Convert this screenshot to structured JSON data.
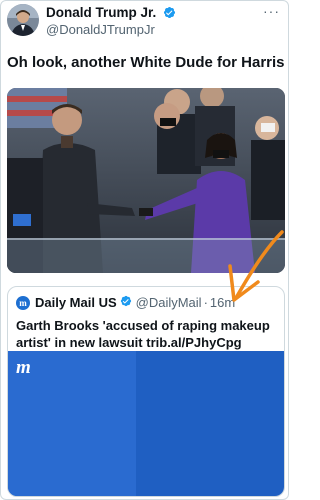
{
  "post": {
    "author_name": "Donald Trump Jr.",
    "author_handle": "@DonaldJTrumpJr",
    "text": "Oh look, another White Dude for Harris",
    "more_label": "···"
  },
  "quoted_post": {
    "logo_letter": "m",
    "author_name": "Daily Mail US",
    "author_handle": "@DailyMail",
    "separator": "·",
    "time": "16m",
    "text": "Garth Brooks 'accused of raping makeup artist' in new lawsuit",
    "link": "trib.al/PJhyCpg",
    "media_mark": "m"
  },
  "colors": {
    "verified": "#1d9bf0",
    "annotation_arrow": "#f08a1c",
    "dailymail_blue": "#1f5fc2"
  },
  "icons": [
    "verified-badge-icon",
    "more-options-icon",
    "annotation-arrow-icon"
  ]
}
